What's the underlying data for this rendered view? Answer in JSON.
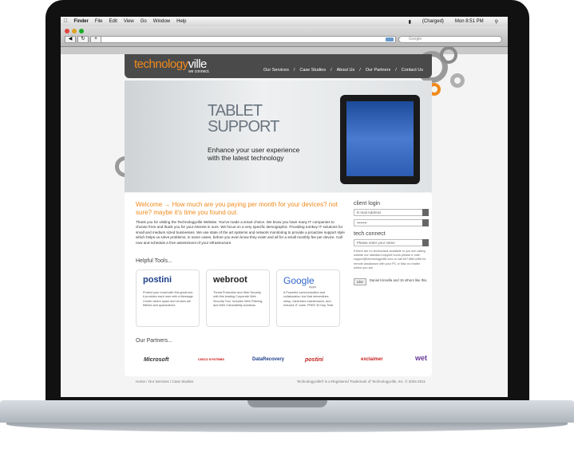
{
  "menubar": {
    "apple": "",
    "items": [
      "Finder",
      "File",
      "Edit",
      "View",
      "Go",
      "Window",
      "Help"
    ],
    "battery": "(Charged)",
    "clock": "Mon 8:51 PM"
  },
  "browser": {
    "search_placeholder": "Google",
    "rss": "RSS"
  },
  "site": {
    "logo_a": "technology",
    "logo_b": "ville",
    "tagline": "we connect.",
    "nav": [
      "Our Services",
      "/",
      "Case Studies",
      "/",
      "About Us",
      "/",
      "Our Partners",
      "/",
      "Contact Us"
    ]
  },
  "hero": {
    "title_line1": "TABLET",
    "title_line2": "SUPPORT",
    "subtitle_line1": "Enhance your user experience",
    "subtitle_line2": "with the latest technology"
  },
  "main": {
    "welcome": "Welcome → How much are you paying per month for your devices? not sure? maybe it's time you found out.",
    "intro": "Thank you for visiting the Technologyville Website. You've made a smart choice. We know you have many IT companies to choose from and thank you for your interest in ours. We focus on a very specific demographic. Providing turnkey IT solutions for small and medium sized businesses. We use state of the art systems and network monitoring to provide a proactive support style which helps us solve problems, in some cases, before you even know they exist! and all for a small monthly fee per device. Call now and schedule a free assessment of your infrastructure.",
    "helpful_tools": "Helpful Tools...",
    "tools": [
      {
        "logo": "postini",
        "desc": "Protect your email with this great tool. It provides each user with a Message Center where spam and viruses are filtered and quarantined."
      },
      {
        "logo": "webroot",
        "desc": "Threat Protection and Web Security with this leading Corporate Web Security Tool. Includes Web Filtering, and Web Vulnerability solutions."
      },
      {
        "logo": "Google",
        "logo_sub": "Apps",
        "desc": "A Powerful communication and collaboration tool that streamlines setup, minimizes maintenance, and reduces IT costs. FREE 30 Day Trial!"
      }
    ],
    "our_partners": "Our Partners...",
    "partners": [
      "Microsoft",
      "CISCO SYSTEMS",
      "DataRecovery",
      "postini",
      "exclaimer",
      "wet"
    ]
  },
  "sidebar": {
    "client_login": "client login",
    "email_placeholder": "E-mail Address",
    "password_value": "••••••••",
    "tech_connect": "tech connect",
    "name_placeholder": "Please enter your name",
    "note": "If there are no technicians available or you are calling outside our standard support hours please e-mail support@technologyville.com or call 847.888.4460 for remote assistance with your PC or Mac no matter where you are.",
    "like_label": "Like",
    "like_text": "Daniel Kinsella and 19 others like this."
  },
  "footer": {
    "left": "Home / Our Services / Case Studies",
    "right": "Technologyville® is a Registered Trademark of Technologyville, Inc. © 2004-2011"
  },
  "colors": {
    "accent_orange": "#f08a1c",
    "header_gray": "#4a4a4a",
    "circle_gray": "#9a9a9a"
  }
}
